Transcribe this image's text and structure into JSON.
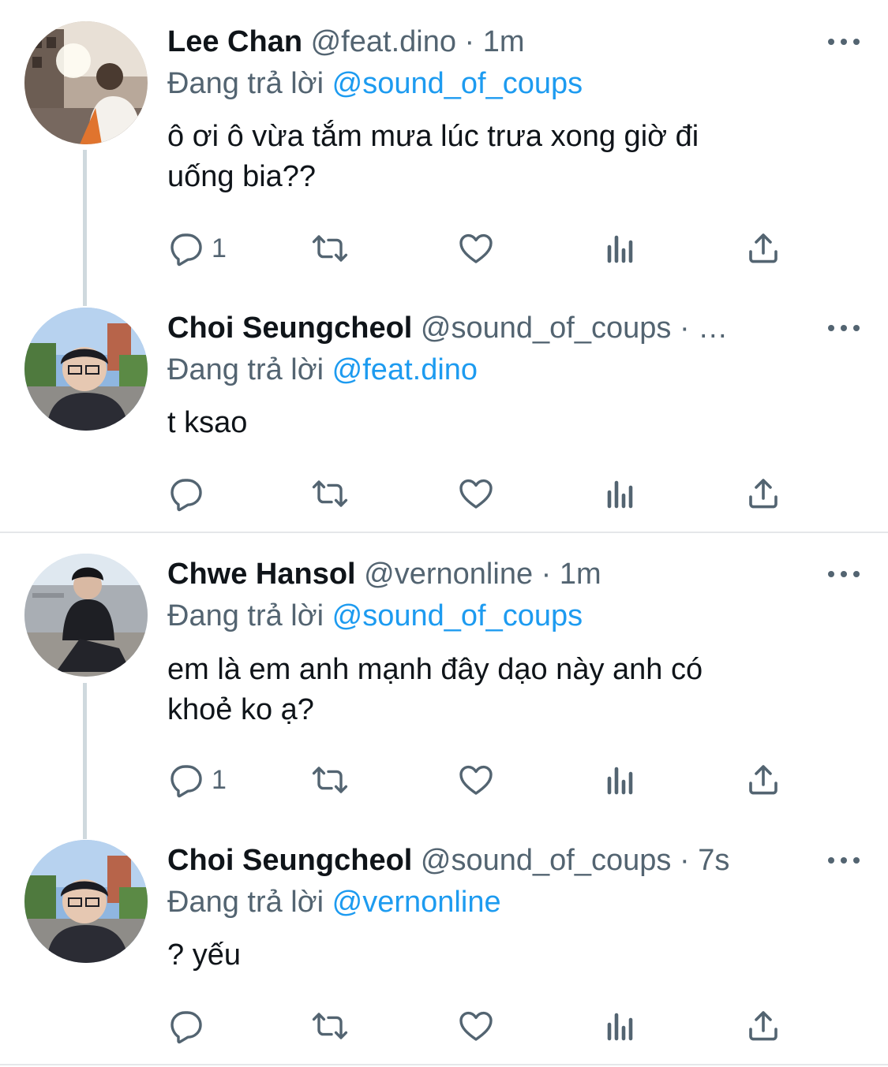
{
  "tweets": [
    {
      "name": "Lee Chan",
      "handle": "@feat.dino",
      "separator": "·",
      "time": "1m",
      "reply_prefix": "Đang trả lời",
      "reply_to": "@sound_of_coups",
      "text_line1": "ô ơi ô vừa tắm mưa lúc trưa xong giờ đi",
      "text_line2": "uống bia??",
      "reply_count": "1"
    },
    {
      "name": "Choi Seungcheol",
      "handle": "@sound_of_coups",
      "separator": "·",
      "time": "…",
      "reply_prefix": "Đang trả lời",
      "reply_to": "@feat.dino",
      "text_line1": "t ksao",
      "reply_count": ""
    },
    {
      "name": "Chwe Hansol",
      "handle": "@vernonline",
      "separator": "·",
      "time": "1m",
      "reply_prefix": "Đang trả lời",
      "reply_to": "@sound_of_coups",
      "text_line1": "em là em anh mạnh đây dạo này anh có",
      "text_line2": "khoẻ ko ạ?",
      "reply_count": "1"
    },
    {
      "name": "Choi Seungcheol",
      "handle": "@sound_of_coups",
      "separator": "·",
      "time": "7s",
      "reply_prefix": "Đang trả lời",
      "reply_to": "@vernonline",
      "text_line1": "? yếu",
      "reply_count": ""
    }
  ],
  "icons": {
    "reply": "reply-icon",
    "retweet": "retweet-icon",
    "like": "heart-icon",
    "views": "analytics-icon",
    "share": "share-icon",
    "more": "more-icon"
  },
  "colors": {
    "text": "#0f1419",
    "secondary": "#536471",
    "link": "#1d9bf0",
    "thread_line": "#cfd9de",
    "separator": "#e5e7ea"
  }
}
